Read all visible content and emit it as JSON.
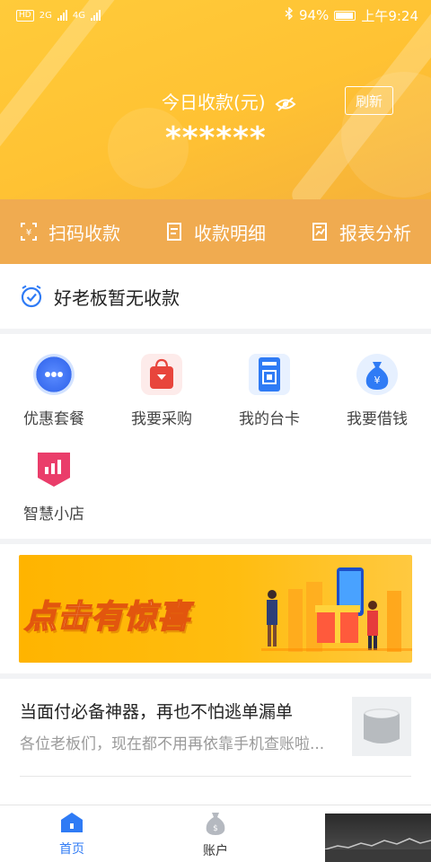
{
  "status_bar": {
    "carrier_badge": "HD",
    "network_1": "2G",
    "network_2": "4G",
    "battery": "94%",
    "time": "上午9:24"
  },
  "hero": {
    "label": "今日收款(元)",
    "amount": "******",
    "refresh_label": "刷新"
  },
  "actions": [
    {
      "label": "扫码收款",
      "icon": "scan-icon"
    },
    {
      "label": "收款明细",
      "icon": "list-icon"
    },
    {
      "label": "报表分析",
      "icon": "report-icon"
    }
  ],
  "notice": {
    "text": "好老板暂无收款"
  },
  "services": [
    {
      "label": "优惠套餐",
      "icon": "chat-bubble-icon"
    },
    {
      "label": "我要采购",
      "icon": "shopping-bag-icon"
    },
    {
      "label": "我的台卡",
      "icon": "qr-card-icon"
    },
    {
      "label": "我要借钱",
      "icon": "money-bag-icon"
    },
    {
      "label": "智慧小店",
      "icon": "shop-chart-icon"
    }
  ],
  "banner": {
    "text": "点击有惊喜"
  },
  "article": {
    "title": "当面付必备神器，再也不怕逃单漏单",
    "subtitle": "各位老板们，现在都不用再依靠手机查账啦..."
  },
  "tabs": [
    {
      "label": "首页",
      "active": true,
      "icon": "home-icon"
    },
    {
      "label": "账户",
      "active": false,
      "icon": "wallet-icon"
    }
  ],
  "colors": {
    "accent_blue": "#2f7bf5",
    "hero_yellow": "#ffc233",
    "action_bar": "#f0ab50"
  }
}
